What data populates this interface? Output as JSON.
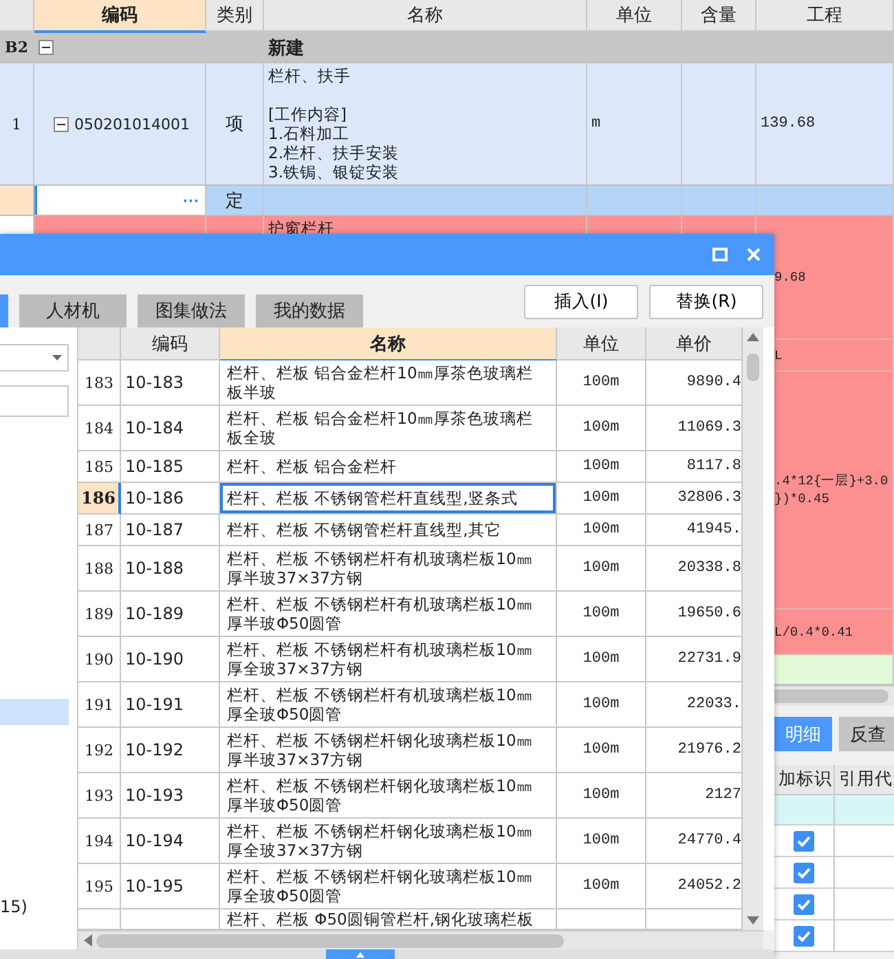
{
  "sheet": {
    "columns": [
      {
        "label": "编码",
        "selected": true
      },
      {
        "label": "类别",
        "selected": false
      },
      {
        "label": "名称",
        "selected": false
      },
      {
        "label": "单位",
        "selected": false
      },
      {
        "label": "含量",
        "selected": false
      },
      {
        "label": "工程",
        "selected": false
      }
    ],
    "rows": [
      {
        "kind": "group",
        "num": "B2",
        "expanded": true,
        "name": "新建"
      },
      {
        "kind": "item",
        "num": "1",
        "expanded": true,
        "code": "050201014001",
        "type": "项",
        "name": {
          "title": "栏杆、扶手",
          "lines": [
            "[工作内容]",
            "1.石料加工",
            "2.栏杆、扶手安装",
            "3.铁锔、银锭安装"
          ]
        },
        "unit": "m",
        "quantity": [
          "139.68"
        ]
      },
      {
        "kind": "edit",
        "type": "定",
        "button": "···"
      },
      {
        "kind": "sub",
        "name": [
          "护窗栏杆"
        ],
        "quantity": [
          "9.68"
        ]
      },
      {
        "kind": "sub",
        "quantity": [
          "L"
        ]
      },
      {
        "kind": "sub",
        "quantity": [
          ".4*12{一层}+3.0",
          "})*0.45"
        ]
      },
      {
        "kind": "sub",
        "quantity": [
          "L/0.4*0.41"
        ]
      },
      {
        "kind": "total"
      }
    ]
  },
  "detail_panel": {
    "tabs": [
      {
        "label": "明细",
        "selected": true
      },
      {
        "label": "反查",
        "selected": false
      }
    ],
    "columns": [
      "加标识",
      "引用代"
    ],
    "rows": [
      {
        "kind": "blank"
      },
      {
        "kind": "check",
        "checked": true
      },
      {
        "kind": "check",
        "checked": true
      },
      {
        "kind": "check",
        "checked": true
      },
      {
        "kind": "check",
        "checked": true
      }
    ]
  },
  "dialog": {
    "tabs": [
      {
        "selected": true
      },
      {
        "label": "人材机",
        "selected": false
      },
      {
        "label": "图集做法",
        "selected": false
      },
      {
        "label": "我的数据",
        "selected": false
      }
    ],
    "buttons": [
      "插入(I)",
      "替换(R)"
    ],
    "tree": [
      {
        "selected": true
      },
      {
        "label": "15)",
        "selected": false
      }
    ],
    "columns": [
      {
        "label": "编码",
        "selected": false
      },
      {
        "label": "名称",
        "selected": true
      },
      {
        "label": "单位",
        "selected": false
      },
      {
        "label": "单价",
        "selected": false
      }
    ],
    "rows": [
      {
        "num": "183",
        "code": "10-183",
        "name": "栏杆、栏板 铝合金栏杆10㎜厚茶色玻璃栏板半玻",
        "unit": "100m",
        "price": "9890.4",
        "selected": false
      },
      {
        "num": "184",
        "code": "10-184",
        "name": "栏杆、栏板 铝合金栏杆10㎜厚茶色玻璃栏板全玻",
        "unit": "100m",
        "price": "11069.3",
        "selected": false
      },
      {
        "num": "185",
        "code": "10-185",
        "name": "栏杆、栏板 铝合金栏杆",
        "unit": "100m",
        "price": "8117.8",
        "selected": false
      },
      {
        "num": "186",
        "code": "10-186",
        "name": "栏杆、栏板 不锈钢管栏杆直线型,竖条式",
        "unit": "100m",
        "price": "32806.3",
        "selected": true
      },
      {
        "num": "187",
        "code": "10-187",
        "name": "栏杆、栏板 不锈钢管栏杆直线型,其它",
        "unit": "100m",
        "price": "41945.",
        "selected": false
      },
      {
        "num": "188",
        "code": "10-188",
        "name": "栏杆、栏板 不锈钢栏杆有机玻璃栏板10㎜厚半玻37×37方钢",
        "unit": "100m",
        "price": "20338.8",
        "selected": false
      },
      {
        "num": "189",
        "code": "10-189",
        "name": "栏杆、栏板 不锈钢栏杆有机玻璃栏板10㎜厚半玻Φ50圆管",
        "unit": "100m",
        "price": "19650.6",
        "selected": false
      },
      {
        "num": "190",
        "code": "10-190",
        "name": "栏杆、栏板 不锈钢栏杆有机玻璃栏板10㎜厚全玻37×37方钢",
        "unit": "100m",
        "price": "22731.9",
        "selected": false
      },
      {
        "num": "191",
        "code": "10-191",
        "name": "栏杆、栏板 不锈钢栏杆有机玻璃栏板10㎜厚全玻Φ50圆管",
        "unit": "100m",
        "price": "22033.",
        "selected": false
      },
      {
        "num": "192",
        "code": "10-192",
        "name": "栏杆、栏板 不锈钢栏杆钢化玻璃栏板10㎜厚半玻37×37方钢",
        "unit": "100m",
        "price": "21976.2",
        "selected": false
      },
      {
        "num": "193",
        "code": "10-193",
        "name": "栏杆、栏板 不锈钢栏杆钢化玻璃栏板10㎜厚半玻Φ50圆管",
        "unit": "100m",
        "price": "2127",
        "selected": false
      },
      {
        "num": "194",
        "code": "10-194",
        "name": "栏杆、栏板 不锈钢栏杆钢化玻璃栏板10㎜厚全玻37×37方钢",
        "unit": "100m",
        "price": "24770.4",
        "selected": false
      },
      {
        "num": "195",
        "code": "10-195",
        "name": "栏杆、栏板 不锈钢栏杆钢化玻璃栏板10㎜厚全玻Φ50圆管",
        "unit": "100m",
        "price": "24052.2",
        "selected": false
      },
      {
        "name": "栏杆、栏板 Φ50圆铜管栏杆,钢化玻璃栏板",
        "selected": false
      }
    ]
  }
}
